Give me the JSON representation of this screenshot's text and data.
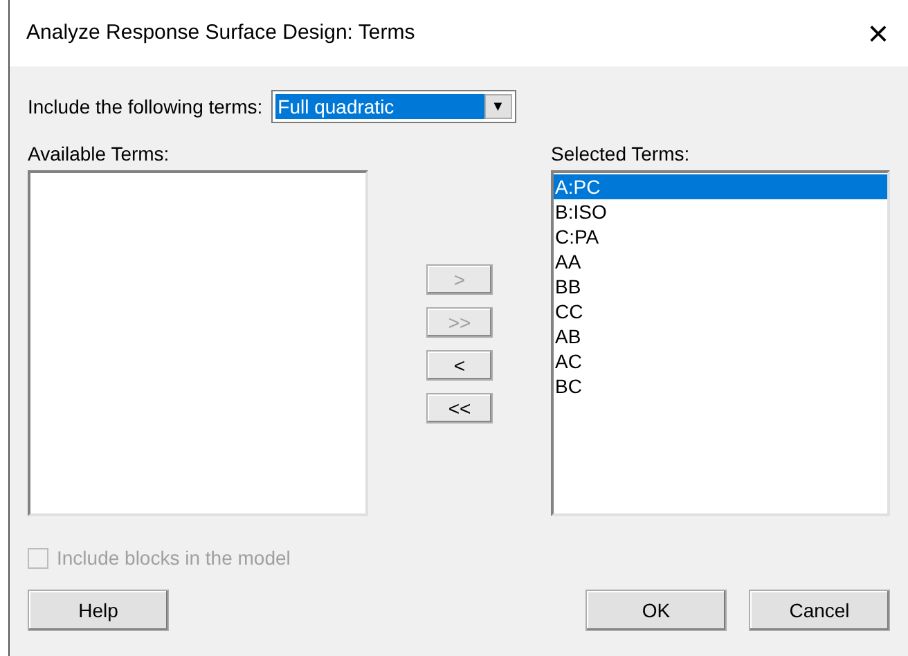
{
  "window": {
    "title": "Analyze Response Surface Design: Terms",
    "close": "×"
  },
  "include": {
    "label": "Include the following terms:",
    "value": "Full quadratic",
    "arrow": "▼"
  },
  "available_terms": {
    "label": "Available Terms:"
  },
  "move_buttons": [
    {
      "label": ">",
      "disabled": true
    },
    {
      "label": ">>",
      "disabled": true
    },
    {
      "label": "<",
      "disabled": false
    },
    {
      "label": "<<",
      "disabled": false
    }
  ],
  "selected_terms": {
    "label": "Selected Terms:",
    "items": [
      {
        "text": "A:PC",
        "selected": true
      },
      {
        "text": "B:ISO",
        "selected": false
      },
      {
        "text": "C:PA",
        "selected": false
      },
      {
        "text": "AA",
        "selected": false
      },
      {
        "text": "BB",
        "selected": false
      },
      {
        "text": "CC",
        "selected": false
      },
      {
        "text": "AB",
        "selected": false
      },
      {
        "text": "AC",
        "selected": false
      },
      {
        "text": "BC",
        "selected": false
      }
    ]
  },
  "blocks_checkbox": {
    "label": "Include blocks in the model",
    "checked": false,
    "disabled": true
  },
  "buttons": [
    {
      "label": "Help"
    },
    {
      "label": "OK",
      "default": true
    },
    {
      "label": "Cancel"
    }
  ]
}
